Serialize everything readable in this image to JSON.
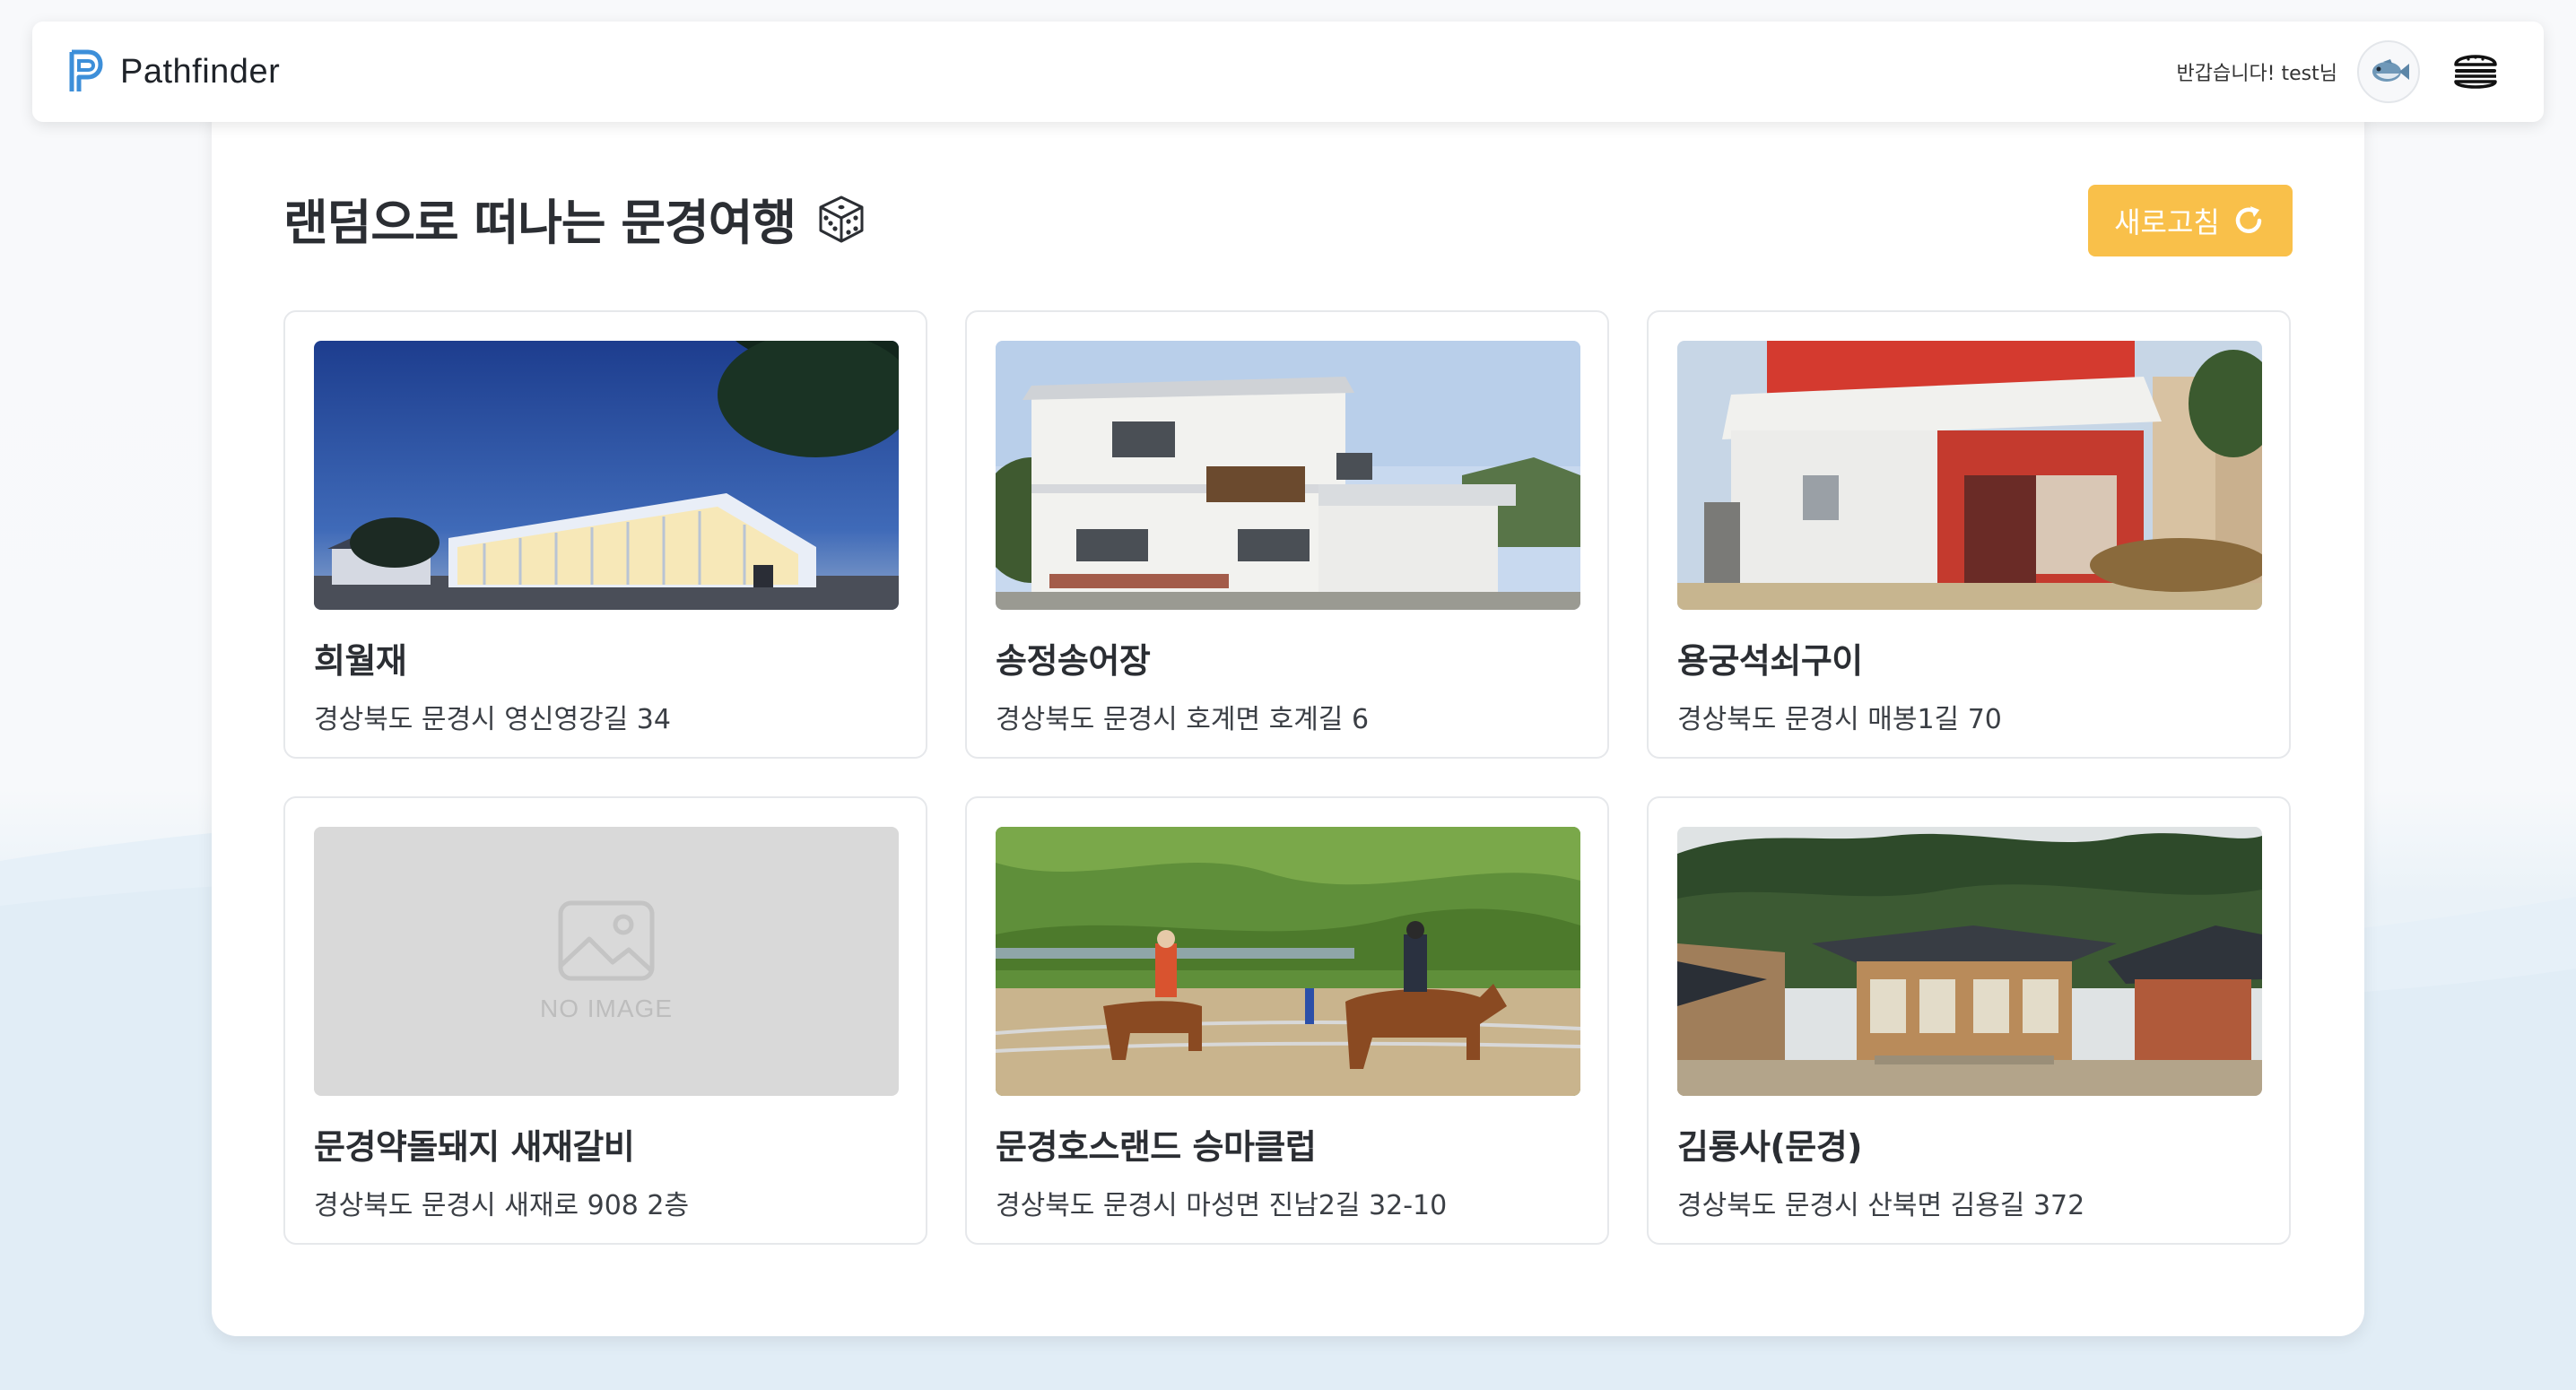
{
  "header": {
    "app_name": "Pathfinder",
    "greeting": "반갑습니다! test님",
    "icons": {
      "logo": "pathfinder-logo",
      "avatar": "fish-avatar",
      "menu": "hamburger-menu-icon"
    }
  },
  "main": {
    "title": "랜덤으로 떠나는 문경여행",
    "title_icon": "dice-icon",
    "refresh_label": "새로고침",
    "refresh_icon": "refresh-icon",
    "accent_color": "#f9c04a",
    "no_image_label": "NO IMAGE",
    "places": [
      {
        "name": "희월재",
        "address": "경상북도 문경시 영신영강길 34",
        "image": "glass-house-night"
      },
      {
        "name": "송정송어장",
        "address": "경상북도 문경시 호계면 호계길 6",
        "image": "white-building"
      },
      {
        "name": "용궁석쇠구이",
        "address": "경상북도 문경시 매봉1길 70",
        "image": "red-restaurant"
      },
      {
        "name": "문경약돌돼지 새재갈비",
        "address": "경상북도 문경시 새재로 908 2층",
        "image": "none"
      },
      {
        "name": "문경호스랜드 승마클럽",
        "address": "경상북도 문경시 마성면 진남2길 32-10",
        "image": "horse-riding"
      },
      {
        "name": "김룡사(문경)",
        "address": "경상북도 문경시 산북면 김용길 372",
        "image": "temple"
      }
    ]
  }
}
